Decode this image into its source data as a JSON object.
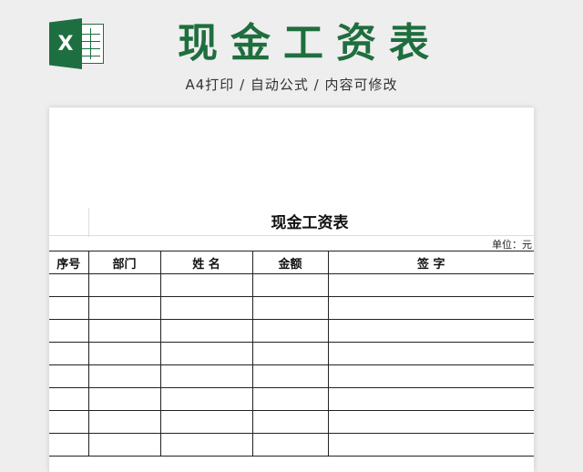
{
  "header": {
    "logo_letter": "X",
    "title": "现金工资表",
    "subtitle": "A4打印 / 自动公式 / 内容可修改",
    "brand_color": "#1f6e3e"
  },
  "sheet": {
    "title": "现金工资表",
    "unit": "单位：元",
    "columns": [
      "序号",
      "部门",
      "姓 名",
      "金额",
      "签 字"
    ],
    "rows": [
      [
        "",
        "",
        "",
        "",
        ""
      ],
      [
        "",
        "",
        "",
        "",
        ""
      ],
      [
        "",
        "",
        "",
        "",
        ""
      ],
      [
        "",
        "",
        "",
        "",
        ""
      ],
      [
        "",
        "",
        "",
        "",
        ""
      ],
      [
        "",
        "",
        "",
        "",
        ""
      ],
      [
        "",
        "",
        "",
        "",
        ""
      ],
      [
        "",
        "",
        "",
        "",
        ""
      ]
    ]
  }
}
